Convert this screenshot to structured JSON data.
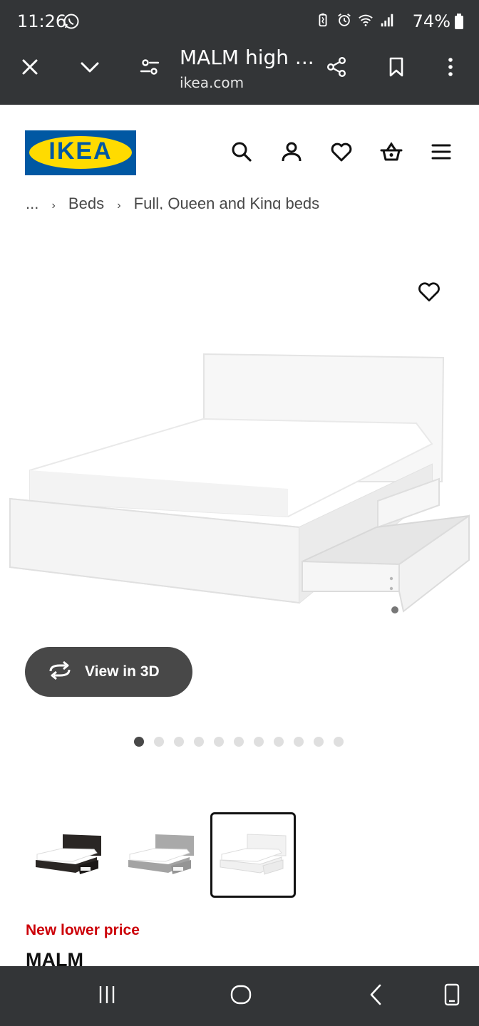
{
  "status_bar": {
    "time": "11:26",
    "battery": "74%",
    "icons": [
      "whatsapp-icon",
      "battery-saver-icon",
      "alarm-icon",
      "wifi-icon",
      "signal-icon",
      "battery-icon"
    ]
  },
  "browser": {
    "page_title": "MALM high ...",
    "domain": "ikea.com",
    "buttons": [
      "close-icon",
      "chevron-down-icon",
      "page-settings-icon",
      "share-icon",
      "bookmark-icon",
      "more-vert-icon"
    ]
  },
  "header": {
    "logo_text": "IKEA",
    "icons": [
      "search-icon",
      "account-icon",
      "heart-icon",
      "basket-icon",
      "menu-icon"
    ]
  },
  "breadcrumb": [
    "...",
    "Beds",
    "Full, Queen and King beds"
  ],
  "gallery": {
    "view_3d_label": "View in 3D",
    "dot_count": 11,
    "active_dot": 1
  },
  "thumbnails": [
    {
      "color": "black-brown",
      "selected": false
    },
    {
      "color": "gray",
      "selected": false
    },
    {
      "color": "white",
      "selected": true
    }
  ],
  "product": {
    "price_tag": "New lower price",
    "name": "MALM"
  },
  "colors": {
    "ikea_blue": "#0058a3",
    "ikea_yellow": "#ffdb00",
    "price_red": "#cc0008",
    "chrome_dark": "#333537",
    "button_dark": "#484848"
  }
}
